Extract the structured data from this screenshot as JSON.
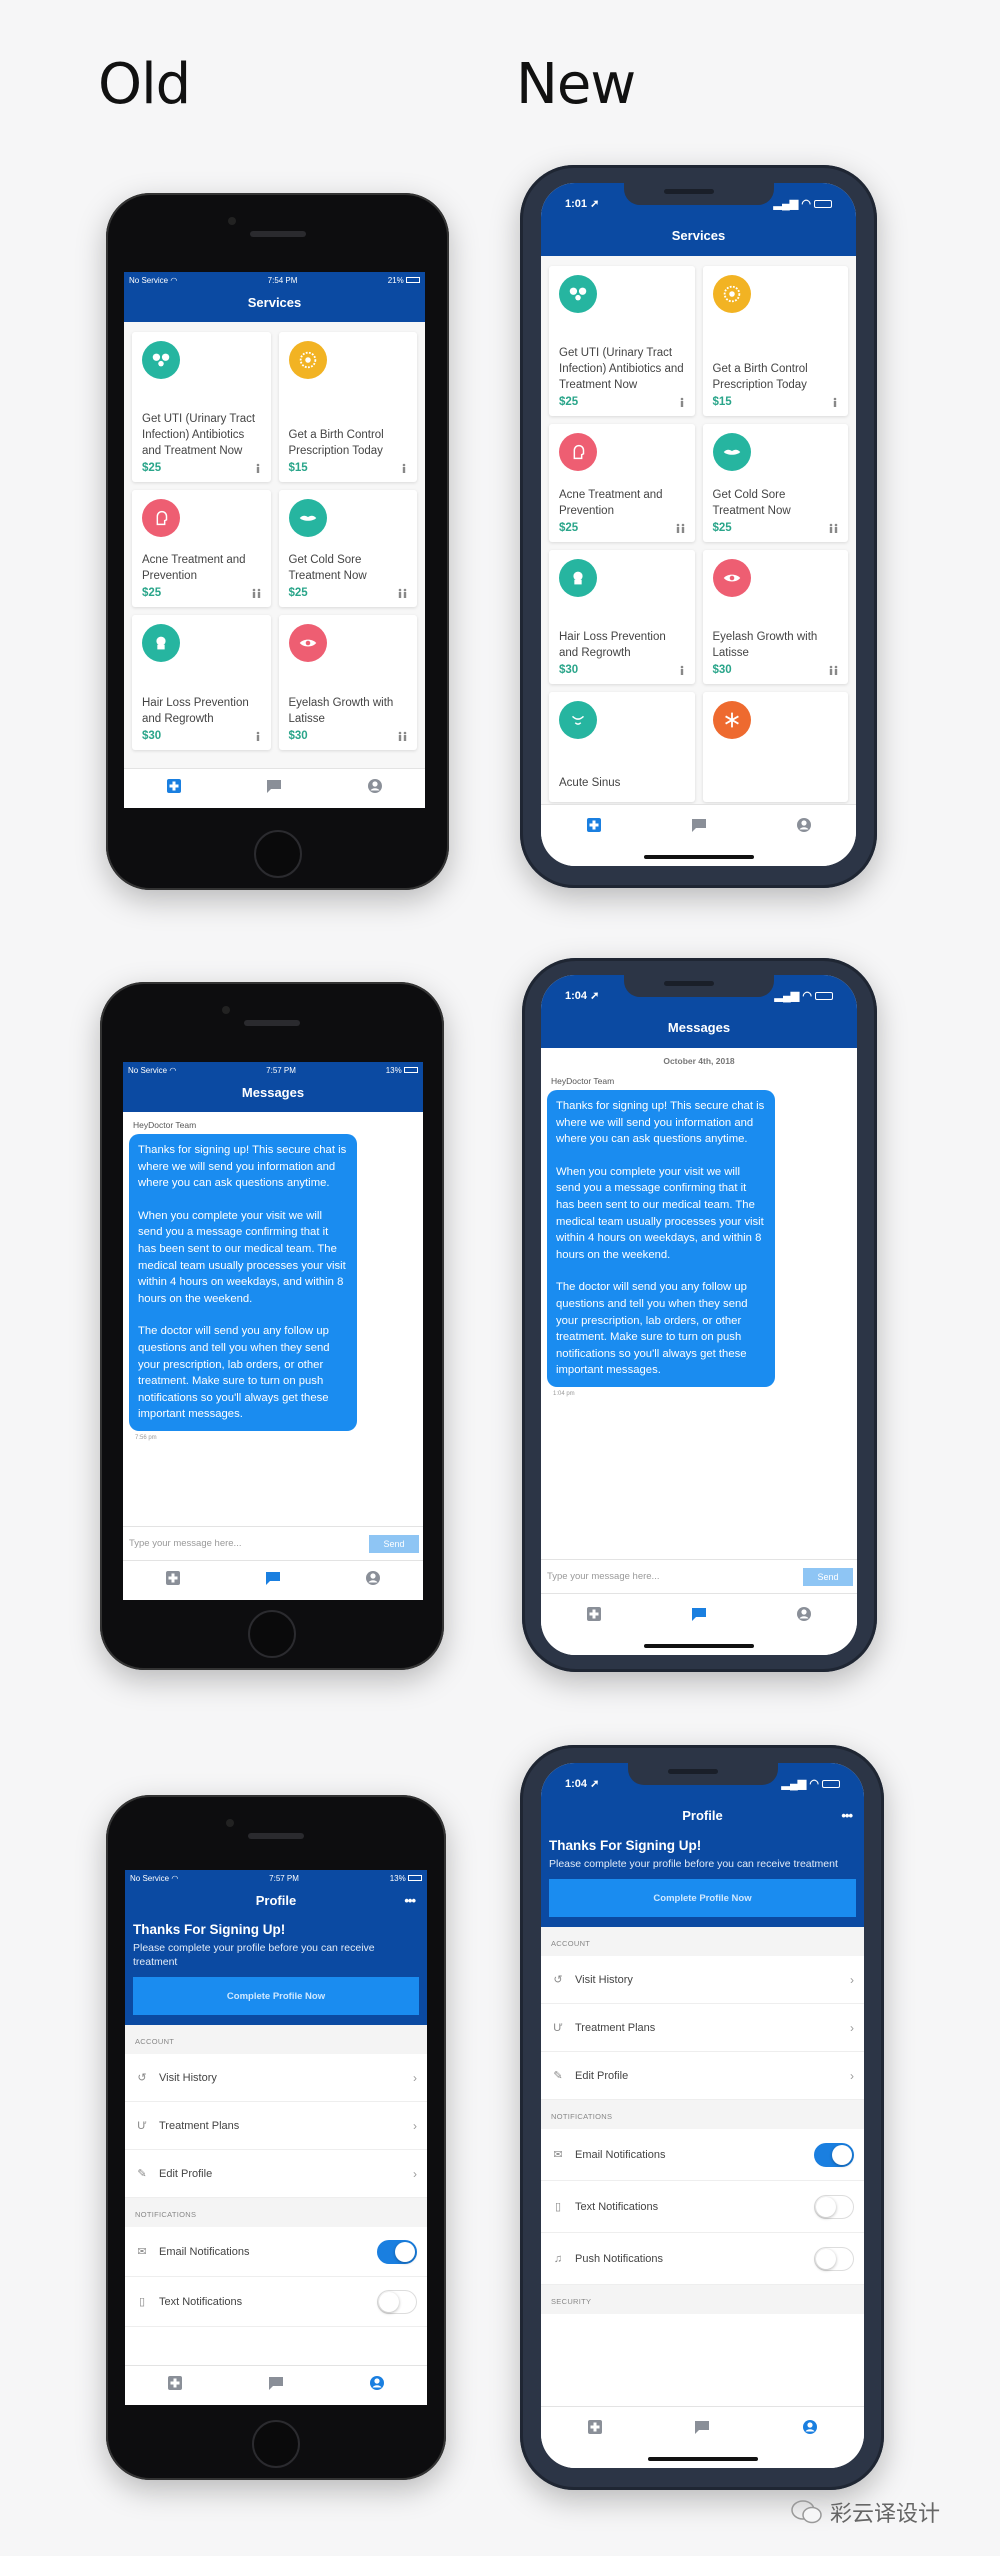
{
  "labels": {
    "old": "Old",
    "new": "New"
  },
  "colors": {
    "header": "#0b4aa2",
    "bubble": "#1a8cf0",
    "price": "#2aa58a",
    "active_tab": "#1a7fe0",
    "teal": "#26b5a0",
    "yellow": "#f2b323",
    "pink": "#ee5e72",
    "orange": "#ee6a2f"
  },
  "tabs": [
    {
      "icon": "medical-plus-icon"
    },
    {
      "icon": "chat-bubble-icon"
    },
    {
      "icon": "user-circle-icon"
    }
  ],
  "services_items": [
    {
      "title": "Get UTI (Urinary Tract Infection) Antibiotics and Treatment Now",
      "price": "$25",
      "color": "teal",
      "icon": "kidney-icon",
      "gender": "female-icon"
    },
    {
      "title": "Get a Birth Control Prescription Today",
      "price": "$15",
      "color": "yellow",
      "icon": "pill-pack-icon",
      "gender": "female-icon"
    },
    {
      "title": "Acne Treatment and Prevention",
      "price": "$25",
      "color": "pink",
      "icon": "face-icon",
      "gender": "male-female-icon"
    },
    {
      "title": "Get Cold Sore Treatment Now",
      "price": "$25",
      "color": "teal",
      "icon": "lips-icon",
      "gender": "male-female-icon"
    },
    {
      "title": "Hair Loss Prevention and Regrowth",
      "price": "$30",
      "color": "teal",
      "icon": "head-icon",
      "gender": "male-icon"
    },
    {
      "title": "Eyelash Growth with Latisse",
      "price": "$30",
      "color": "pink",
      "icon": "eye-icon",
      "gender": "male-female-icon"
    },
    {
      "title": "Acute Sinus",
      "price": "",
      "color": "teal",
      "icon": "nose-icon",
      "gender": ""
    },
    {
      "title": "",
      "price": "",
      "color": "orange",
      "icon": "asterisk-icon",
      "gender": ""
    }
  ],
  "message": {
    "sender": "HeyDoctor Team",
    "paragraphs": [
      "Thanks for signing up! This secure chat is where we will send you information and where you can ask questions anytime.",
      "When you complete your visit we will send you a message confirming that it has been sent to our medical team. The medical team usually processes your visit within 4 hours on weekdays, and within 8 hours on the weekend.",
      "The doctor will send you any follow up questions and tell you when they send your prescription, lab orders, or other treatment. Make sure to turn on push notifications so you'll always get these important messages."
    ],
    "placeholder": "Type your message here...",
    "send": "Send"
  },
  "profile": {
    "heading": "Thanks For Signing Up!",
    "subtext": "Please complete your profile before you can receive treatment",
    "button": "Complete Profile Now",
    "more": "•••",
    "account_label": "ACCOUNT",
    "account_rows": [
      {
        "label": "Visit History",
        "icon": "history-icon"
      },
      {
        "label": "Treatment Plans",
        "icon": "stethoscope-icon"
      },
      {
        "label": "Edit Profile",
        "icon": "pencil-icon"
      }
    ],
    "notifications_label": "NOTIFICATIONS",
    "notification_rows": [
      {
        "label": "Email Notifications",
        "icon": "mail-icon",
        "on": true
      },
      {
        "label": "Text Notifications",
        "icon": "phone-icon",
        "on": false
      },
      {
        "label": "Push Notifications",
        "icon": "bell-icon",
        "on": false
      }
    ],
    "security_label": "SECURITY"
  },
  "screens": {
    "old_services": {
      "status_left": "No Service",
      "time": "7:54 PM",
      "battery": "21%",
      "title": "Services"
    },
    "new_services": {
      "time": "1:01",
      "title": "Services"
    },
    "old_messages": {
      "status_left": "No Service",
      "time": "7:57 PM",
      "battery": "13%",
      "title": "Messages",
      "timestamp": "7:56 pm"
    },
    "new_messages": {
      "time": "1:04",
      "title": "Messages",
      "date": "October 4th, 2018",
      "timestamp": "1:04 pm"
    },
    "old_profile": {
      "status_left": "No Service",
      "time": "7:57 PM",
      "battery": "13%",
      "title": "Profile"
    },
    "new_profile": {
      "time": "1:04",
      "title": "Profile"
    }
  },
  "watermark": "彩云译设计"
}
